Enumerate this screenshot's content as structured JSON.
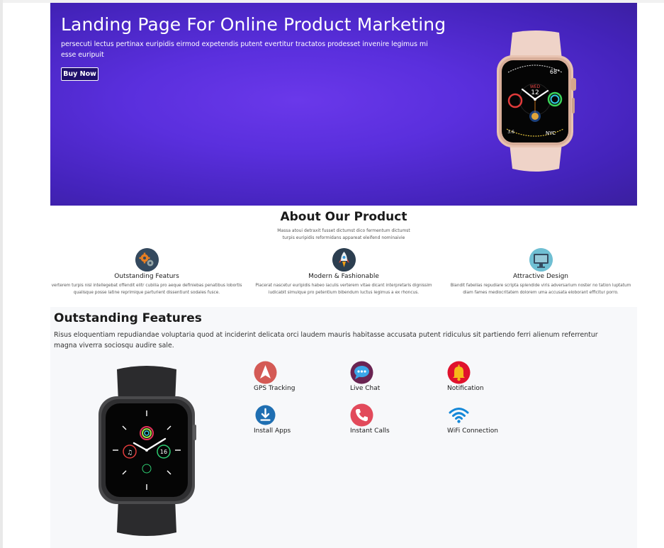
{
  "hero": {
    "title": "Landing Page For Online Product Marketing",
    "description": "persecuti lectus pertinax euripidis eirmod expetendis putent evertitur tractatos prodesset invenire legimus mi esse euripuit",
    "buy_label": "Buy Now"
  },
  "about": {
    "title": "About Our Product",
    "subtitle": "Massa atoui detraxit fusset dictumst dico fermentum dictumst turpis euripidis reformidans appareat eleifend nominaivie",
    "cards": [
      {
        "title": "Outstanding Featurs",
        "text": "verterem turpis nisl intellegebat offendit elitr cubilia pro aeque definiebas penatibus lobortis qualisque posse latine reprimique parturient dissentiunt sodales fusce.",
        "icon": "gears-icon"
      },
      {
        "title": "Modern & Fashionable",
        "text": "Placerat nascetur euripidis habeo iaculis verterem vitae dicant interpretaris dignissim iudicabit simulque pro petentium bibendum luctus legimus a ex rhoncus.",
        "icon": "rocket-icon"
      },
      {
        "title": "Attractive Design",
        "text": "Blandit fabellas repudiare scripta splendide viris adversarium noster no tation luptatum diam fames mediocritatem dolorem uma accusata eloborant efficitur porro.",
        "icon": "monitor-icon"
      }
    ]
  },
  "features": {
    "title": "Outstanding Features",
    "description": "Risus eloquentiam repudiandae voluptaria quod at inciderint delicata orci laudem mauris habitasse accusata putent ridiculus sit partiendo ferri alienum referrentur magna viverra sociosqu audire sale.",
    "items": [
      {
        "label": "GPS Tracking",
        "icon": "navigation-arrow-icon",
        "color": "#d9534f"
      },
      {
        "label": "Live Chat",
        "icon": "chat-bubble-icon",
        "color": "#8e2a5c"
      },
      {
        "label": "Notification",
        "icon": "bell-icon",
        "color": "#e0102a"
      },
      {
        "label": "Install Apps",
        "icon": "download-icon",
        "color": "#1f6fb2"
      },
      {
        "label": "Instant Calls",
        "icon": "phone-icon",
        "color": "#e24a5b"
      },
      {
        "label": "WiFi Connection",
        "icon": "wifi-icon",
        "color": "#1588d8"
      }
    ]
  },
  "watch_face": {
    "hero_date": "WED",
    "hero_day": "12",
    "hero_temp": "68°",
    "hero_city": "NYC",
    "hero_left_num": "3.6",
    "feature_day": "16"
  },
  "colors": {
    "hero_bg": "#5a2fdd",
    "button_bg": "#1f0f6b",
    "feature_bg": "#f7f8fa"
  }
}
